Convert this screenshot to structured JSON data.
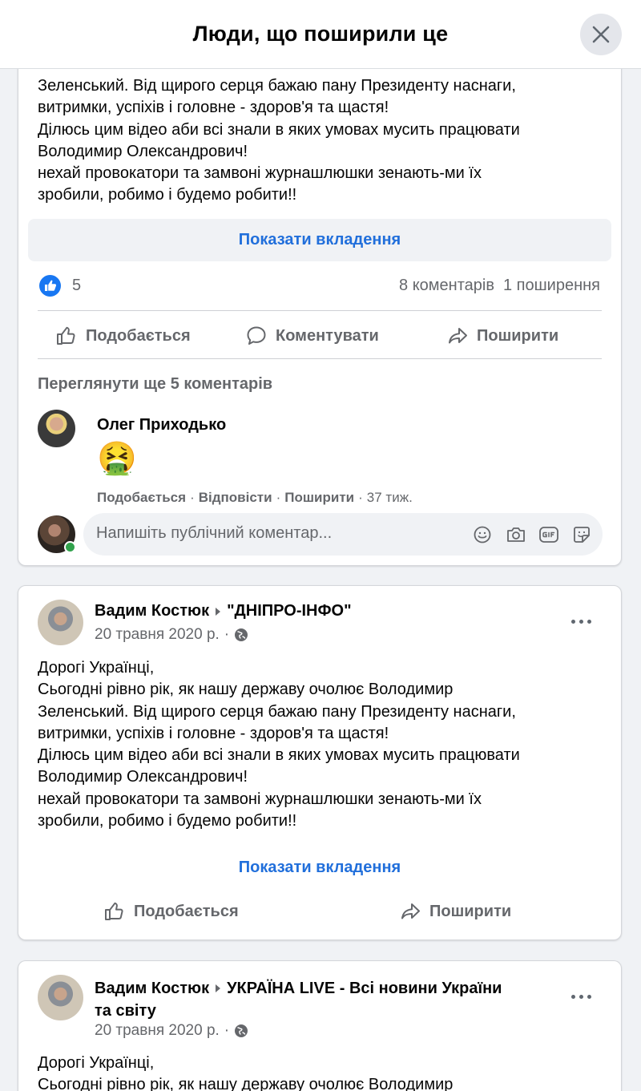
{
  "header": {
    "title": "Люди, що поширили це"
  },
  "card1": {
    "text_lines": [
      "Зеленський. Від щирого серця бажаю пану Президенту наснаги,",
      "витримки, успіхів і головне - здоров'я та щастя!",
      "Ділюсь цим відео аби всі знали в яких умовах мусить працювати",
      "Володимир Олександрович!",
      "нехай провокатори та замвоні журнашлюшки зенають-ми їх",
      "зробили, робимо і будемо робити!!"
    ],
    "show_attachment": "Показати вкладення",
    "like_count": "5",
    "comments_count": "8 коментарів",
    "shares_count": "1 поширення",
    "actions": {
      "like": "Подобається",
      "comment": "Коментувати",
      "share": "Поширити"
    },
    "more_comments": "Переглянути ще 5 коментарів",
    "comment": {
      "author": "Олег Приходько",
      "emoji": "🤮",
      "like": "Подобається",
      "reply": "Відповісти",
      "share": "Поширити",
      "time": "37 тиж.",
      "sep": "·"
    },
    "comment_input": {
      "placeholder": "Напишіть публічний коментар..."
    }
  },
  "card2": {
    "author": "Вадим Костюк",
    "group": "\"ДНІПРО-ІНФО\"",
    "date": "20 травня 2020 р.",
    "sep": "·",
    "text_lines": [
      "Дорогі Українці,",
      "Сьогодні рівно рік, як нашу державу очолює Володимир",
      "Зеленський. Від щирого серця бажаю пану Президенту наснаги,",
      "витримки, успіхів і головне - здоров'я та щастя!",
      "Ділюсь цим відео аби всі знали в яких умовах мусить працювати",
      "Володимир Олександрович!",
      "нехай провокатори та замвоні журнашлюшки зенають-ми їх",
      "зробили, робимо і будемо робити!!"
    ],
    "show_attachment": "Показати вкладення",
    "actions": {
      "like": "Подобається",
      "share": "Поширити"
    }
  },
  "card3": {
    "author": "Вадим Костюк",
    "group_line1": "УКРАЇНА LIVE - Всі новини України",
    "group_line2": "та світу",
    "date": "20 травня 2020 р.",
    "sep": "·",
    "text_lines": [
      "Дорогі Українці,",
      "Сьогодні рівно рік, як нашу державу очолює Володимир"
    ]
  },
  "colors": {
    "link_blue": "#216fdb",
    "muted": "#65676b",
    "online_green": "#31a24c"
  }
}
